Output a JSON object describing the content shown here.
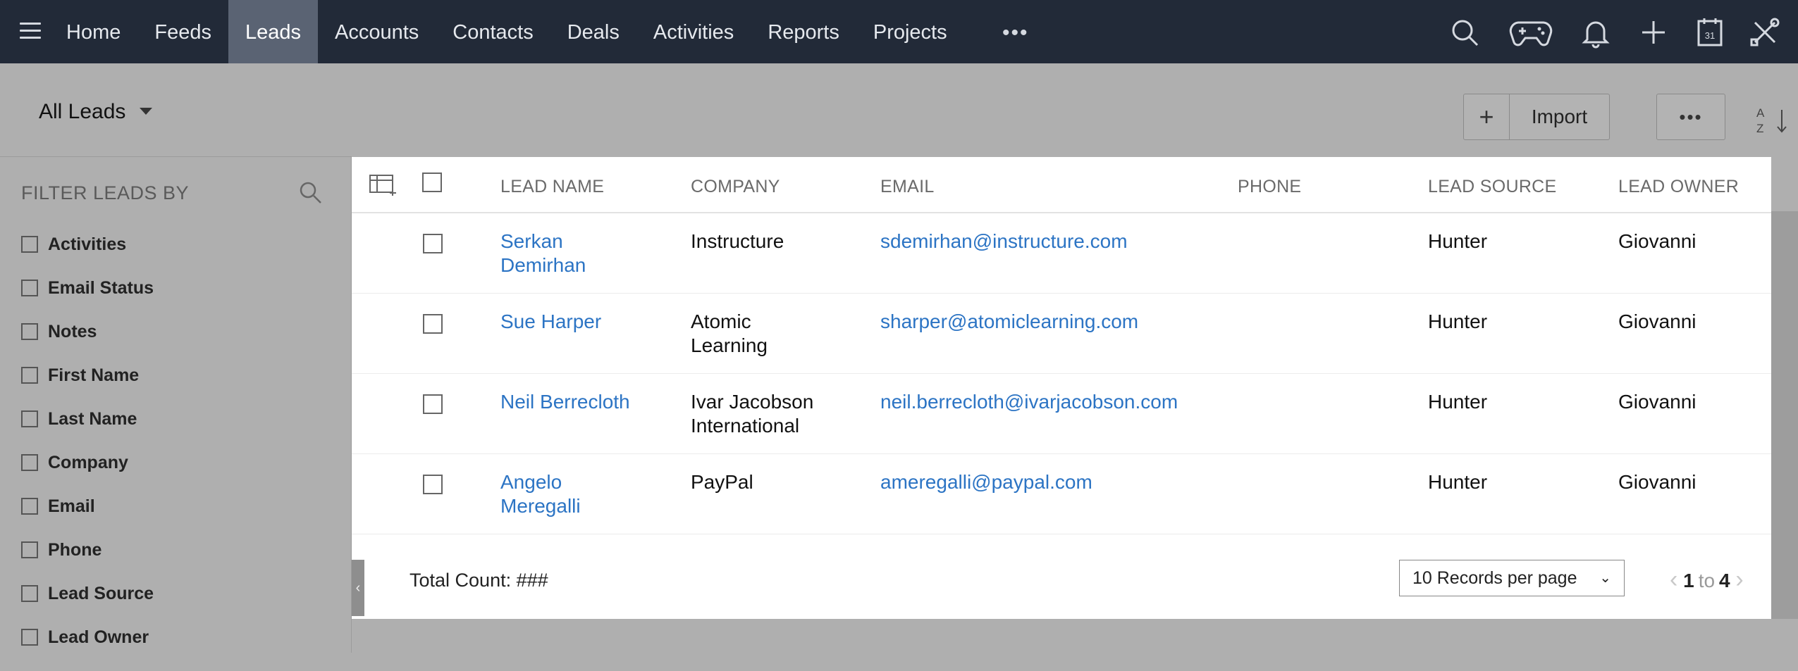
{
  "nav": {
    "tabs": [
      {
        "label": "Home",
        "active": false
      },
      {
        "label": "Feeds",
        "active": false
      },
      {
        "label": "Leads",
        "active": true
      },
      {
        "label": "Accounts",
        "active": false
      },
      {
        "label": "Contacts",
        "active": false
      },
      {
        "label": "Deals",
        "active": false
      },
      {
        "label": "Activities",
        "active": false
      },
      {
        "label": "Reports",
        "active": false
      },
      {
        "label": "Projects",
        "active": false
      }
    ],
    "more_label": "•••",
    "icons": [
      "search-icon",
      "gamepad-icon",
      "bell-icon",
      "plus-icon",
      "calendar-icon",
      "tools-icon"
    ],
    "calendar_day": "31"
  },
  "toolbar": {
    "view_label": "All Leads",
    "plus_label": "+",
    "import_label": "Import",
    "more_label": "•••"
  },
  "filter": {
    "title": "FILTER LEADS BY",
    "items": [
      "Activities",
      "Email Status",
      "Notes",
      "First Name",
      "Last Name",
      "Company",
      "Email",
      "Phone",
      "Lead Source",
      "Lead Owner"
    ]
  },
  "table": {
    "columns": [
      "LEAD NAME",
      "COMPANY",
      "EMAIL",
      "PHONE",
      "LEAD SOURCE",
      "LEAD OWNER"
    ],
    "rows": [
      {
        "name_line1": "Serkan",
        "name_line2": "Demirhan",
        "company_line1": "Instructure",
        "company_line2": "",
        "email": "sdemirhan@instructure.com",
        "phone": "",
        "source": "Hunter",
        "owner": "Giovanni"
      },
      {
        "name_line1": "Sue Harper",
        "name_line2": "",
        "company_line1": "Atomic",
        "company_line2": "Learning",
        "email": "sharper@atomiclearning.com",
        "phone": "",
        "source": "Hunter",
        "owner": "Giovanni"
      },
      {
        "name_line1": "Neil Berrecloth",
        "name_line2": "",
        "company_line1": "Ivar Jacobson",
        "company_line2": "International",
        "email": "neil.berrecloth@ivarjacobson.com",
        "phone": "",
        "source": "Hunter",
        "owner": "Giovanni"
      },
      {
        "name_line1": "Angelo",
        "name_line2": "Meregalli",
        "company_line1": "PayPal",
        "company_line2": "",
        "email": "ameregalli@paypal.com",
        "phone": "",
        "source": "Hunter",
        "owner": "Giovanni"
      }
    ]
  },
  "footer": {
    "total_label": "Total Count: ###",
    "per_page": "10 Records per page",
    "page_from": "1",
    "page_to_word": "to",
    "page_to": "4"
  },
  "colors": {
    "navbar": "#222a38",
    "active_tab": "#5a6373",
    "overlay": "#afafaf",
    "link": "#2c74c4"
  }
}
